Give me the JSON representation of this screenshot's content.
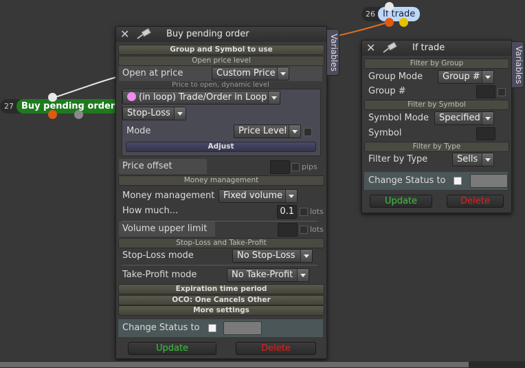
{
  "nodes": {
    "buy": {
      "number": "27",
      "label": "Buy pending order"
    },
    "if_trade": {
      "number": "26",
      "label": "If trade"
    }
  },
  "buy_panel": {
    "title": "Buy pending order",
    "variables_tab": "Variables",
    "sections": {
      "group_symbol": "Group and Symbol to use",
      "open_price_level": "Open price level",
      "money_management": "Money management",
      "sl_tp": "Stop-Loss and Take-Profit",
      "expiration": "Expiration time period",
      "oco": "OCO: One Cancels Other",
      "more_settings": "More settings"
    },
    "open_at_price": {
      "label": "Open at price",
      "value": "Custom Price"
    },
    "hint": "Price to open, dynamic level",
    "loop_select": "(in loop) Trade/Order in Loop",
    "stoploss_select": "Stop-Loss",
    "mode": {
      "label": "Mode",
      "value": "Price Level"
    },
    "adjust": "Adjust",
    "price_offset": {
      "label": "Price offset",
      "unit": "pips"
    },
    "money": {
      "label": "Money management",
      "value": "Fixed volume"
    },
    "how_much": {
      "label": "How much...",
      "value": "0.1",
      "unit": "lots"
    },
    "volume_upper": {
      "label": "Volume upper limit",
      "unit": "lots"
    },
    "sl_mode": {
      "label": "Stop-Loss mode",
      "value": "No Stop-Loss"
    },
    "tp_mode": {
      "label": "Take-Profit mode",
      "value": "No Take-Profit"
    },
    "change_status": "Change Status to",
    "update": "Update",
    "delete": "Delete"
  },
  "if_panel": {
    "title": "If trade",
    "variables_tab": "Variables",
    "sections": {
      "filter_group": "Filter by Group",
      "filter_symbol": "Filter by Symbol",
      "filter_type": "Filter by Type"
    },
    "group_mode": {
      "label": "Group Mode",
      "value": "Group #"
    },
    "group_num": {
      "label": "Group #"
    },
    "symbol_mode": {
      "label": "Symbol Mode",
      "value": "Specified"
    },
    "symbol": {
      "label": "Symbol"
    },
    "filter_type": {
      "label": "Filter by Type",
      "value": "Sells"
    },
    "change_status": "Change Status to",
    "update": "Update",
    "delete": "Delete"
  },
  "colors": {
    "background": "#383838",
    "buy_node": "#1e7a1e",
    "if_node": "#bcd8f8",
    "update_text": "#3cc43c",
    "delete_text": "#e02020",
    "connector": "#e07020"
  }
}
